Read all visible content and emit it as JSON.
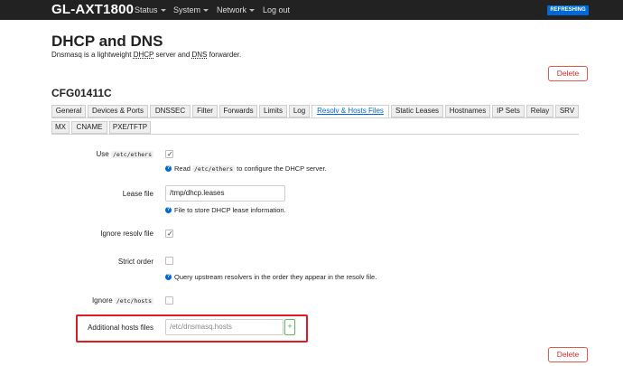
{
  "header": {
    "brand": "GL-AXT1800",
    "menu": [
      "Status",
      "System",
      "Network"
    ],
    "logout": "Log out",
    "badge": "REFRESHING"
  },
  "page": {
    "title": "DHCP and DNS",
    "desc_pre": "Dnsmasq is a lightweight ",
    "desc_dhcp": "DHCP",
    "desc_mid": " server and ",
    "desc_dns": "DNS",
    "desc_post": " forwarder.",
    "delete_label": "Delete"
  },
  "section": {
    "title": "CFG01411C",
    "tabs_row1": [
      "General",
      "Devices & Ports",
      "DNSSEC",
      "Filter",
      "Forwards",
      "Limits",
      "Log",
      "Resolv & Hosts Files",
      "Static Leases",
      "Hostnames",
      "IP Sets",
      "Relay",
      "SRV"
    ],
    "tabs_row2": [
      "MX",
      "CNAME",
      "PXE/TFTP"
    ],
    "active_tab": "Resolv & Hosts Files"
  },
  "form": {
    "use_ethers": {
      "label_pre": "Use ",
      "label_code": "/etc/ethers",
      "checked": true,
      "help_pre": "Read ",
      "help_code": "/etc/ethers",
      "help_post": " to configure the DHCP server."
    },
    "lease_file": {
      "label": "Lease file",
      "value": "/tmp/dhcp.leases",
      "help": "File to store DHCP lease information."
    },
    "ignore_resolv": {
      "label": "Ignore resolv file",
      "checked": true
    },
    "strict_order": {
      "label": "Strict order",
      "checked": false,
      "help": "Query upstream resolvers in the order they appear in the resolv file."
    },
    "ignore_hosts": {
      "label_pre": "Ignore ",
      "label_code": "/etc/hosts",
      "checked": false
    },
    "additional_hosts": {
      "label": "Additional hosts files",
      "placeholder": "/etc/dnsmasq.hosts",
      "add_label": "+"
    }
  },
  "colors": {
    "topbar": "#222222",
    "accent": "#0069d6",
    "danger": "#c9302c",
    "highlight": "#e01b24"
  }
}
